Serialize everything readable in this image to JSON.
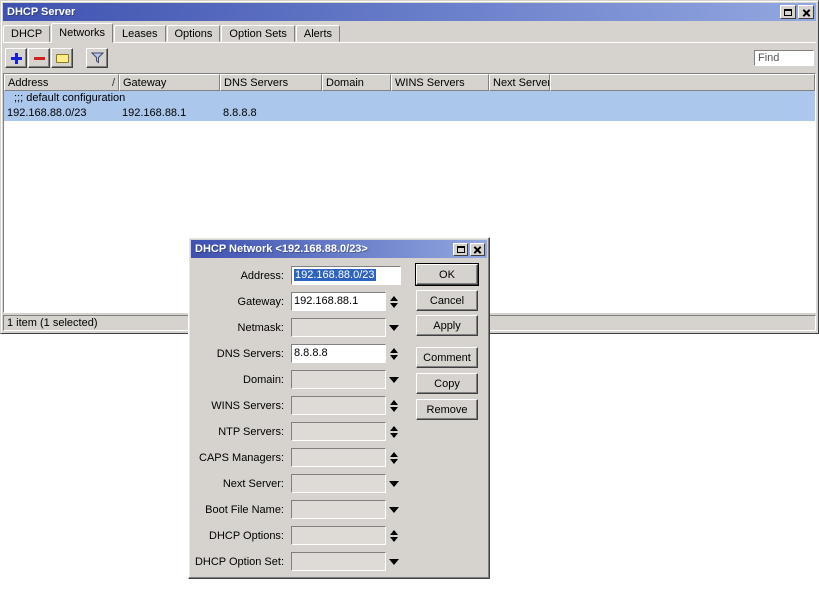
{
  "window": {
    "title": "DHCP Server",
    "tabs": [
      {
        "label": "DHCP",
        "active": false
      },
      {
        "label": "Networks",
        "active": true
      },
      {
        "label": "Leases",
        "active": false
      },
      {
        "label": "Options",
        "active": false
      },
      {
        "label": "Option Sets",
        "active": false
      },
      {
        "label": "Alerts",
        "active": false
      }
    ],
    "toolbar": {
      "find_placeholder": "Find",
      "buttons": [
        "add",
        "remove",
        "comment",
        "filter"
      ]
    },
    "table": {
      "sort_indicator": "/",
      "columns": [
        "Address",
        "Gateway",
        "DNS Servers",
        "Domain",
        "WINS Servers",
        "Next Server"
      ],
      "rows": [
        {
          "type": "comment",
          "comment": ";;; default configuration",
          "selected": true
        },
        {
          "type": "entry",
          "address": "192.168.88.0/23",
          "gateway": "192.168.88.1",
          "dns_servers": "8.8.8.8",
          "domain": "",
          "wins_servers": "",
          "next_server": "",
          "selected": true
        }
      ]
    },
    "status": "1 item (1 selected)"
  },
  "dialog": {
    "title": "DHCP Network <192.168.88.0/23>",
    "fields": [
      {
        "label": "Address:",
        "value": "192.168.88.0/23",
        "control": "none",
        "text_selected": true
      },
      {
        "label": "Gateway:",
        "value": "192.168.88.1",
        "control": "up-down"
      },
      {
        "label": "Netmask:",
        "value": "",
        "control": "dropdown"
      },
      {
        "label": "DNS Servers:",
        "value": "8.8.8.8",
        "control": "up-down"
      },
      {
        "label": "Domain:",
        "value": "",
        "control": "dropdown"
      },
      {
        "label": "WINS Servers:",
        "value": "",
        "control": "up-down"
      },
      {
        "label": "NTP Servers:",
        "value": "",
        "control": "up-down"
      },
      {
        "label": "CAPS Managers:",
        "value": "",
        "control": "up-down"
      },
      {
        "label": "Next Server:",
        "value": "",
        "control": "dropdown"
      },
      {
        "label": "Boot File Name:",
        "value": "",
        "control": "dropdown"
      },
      {
        "label": "DHCP Options:",
        "value": "",
        "control": "up-down"
      },
      {
        "label": "DHCP Option Set:",
        "value": "",
        "control": "dropdown"
      }
    ],
    "buttons": [
      "OK",
      "Cancel",
      "Apply",
      "Comment",
      "Copy",
      "Remove"
    ]
  },
  "icons": {
    "titlebar": [
      "restore-icon",
      "close-icon"
    ],
    "toolbar": [
      "plus-icon",
      "minus-icon",
      "comment-icon",
      "funnel-icon"
    ],
    "field_controls": [
      "up-down-arrows-icon",
      "dropdown-arrow-icon"
    ]
  },
  "colors": {
    "window_bg": "#d6d3ce",
    "titlebar_gradient_start": "#3f51b0",
    "titlebar_gradient_end": "#93a7e0",
    "row_selection": "#abc7ec",
    "selected_text_bg": "#2f63c0"
  }
}
